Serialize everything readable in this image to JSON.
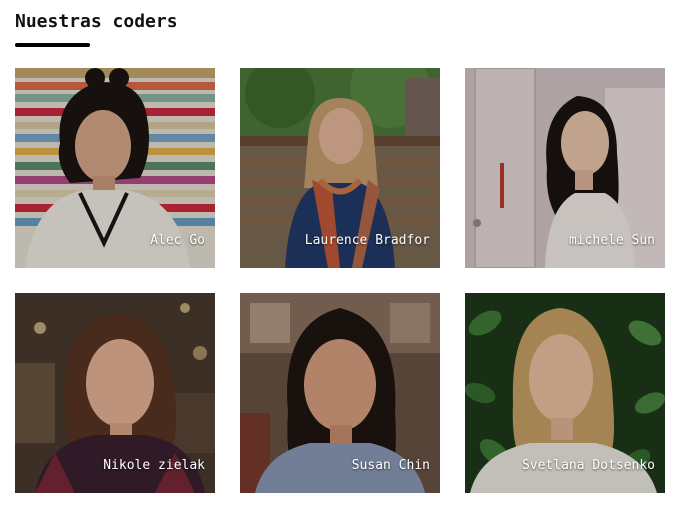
{
  "section": {
    "title": "Nuestras coders"
  },
  "coders": [
    {
      "name": "Alec Go"
    },
    {
      "name": "Laurence Bradfor"
    },
    {
      "name": "michele Sun"
    },
    {
      "name": "Nikole zielak"
    },
    {
      "name": "Susan Chin"
    },
    {
      "name": "Svetlana Dotsenko"
    }
  ]
}
